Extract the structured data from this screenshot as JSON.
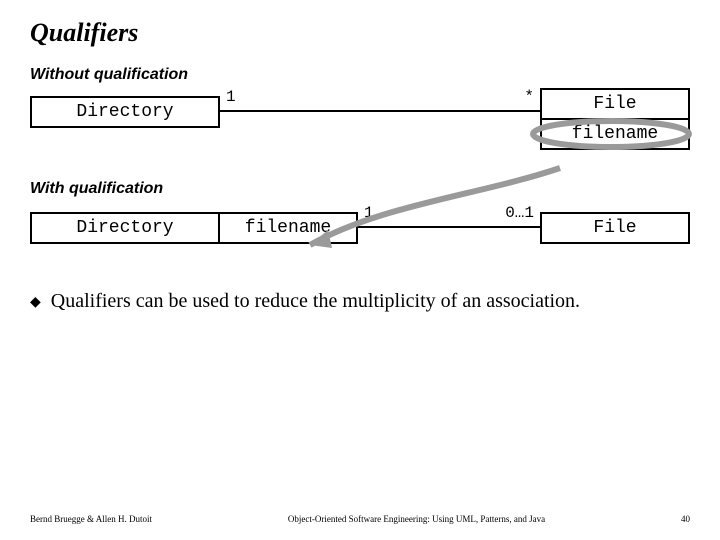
{
  "title": "Qualifiers",
  "sections": {
    "without_label": "Without qualification",
    "with_label": "With qualification"
  },
  "uml": {
    "dir_label": "Directory",
    "file_label": "File",
    "filename_attr": "filename",
    "qualifier_label": "filename",
    "mult_one": "1",
    "mult_star": "*",
    "mult_zero_one": "0…1"
  },
  "bullet": {
    "text": "Qualifiers can be used to reduce the multiplicity of an association."
  },
  "footer": {
    "left": "Bernd Bruegge & Allen H. Dutoit",
    "center": "Object-Oriented Software Engineering: Using UML, Patterns, and Java",
    "right": "40"
  }
}
